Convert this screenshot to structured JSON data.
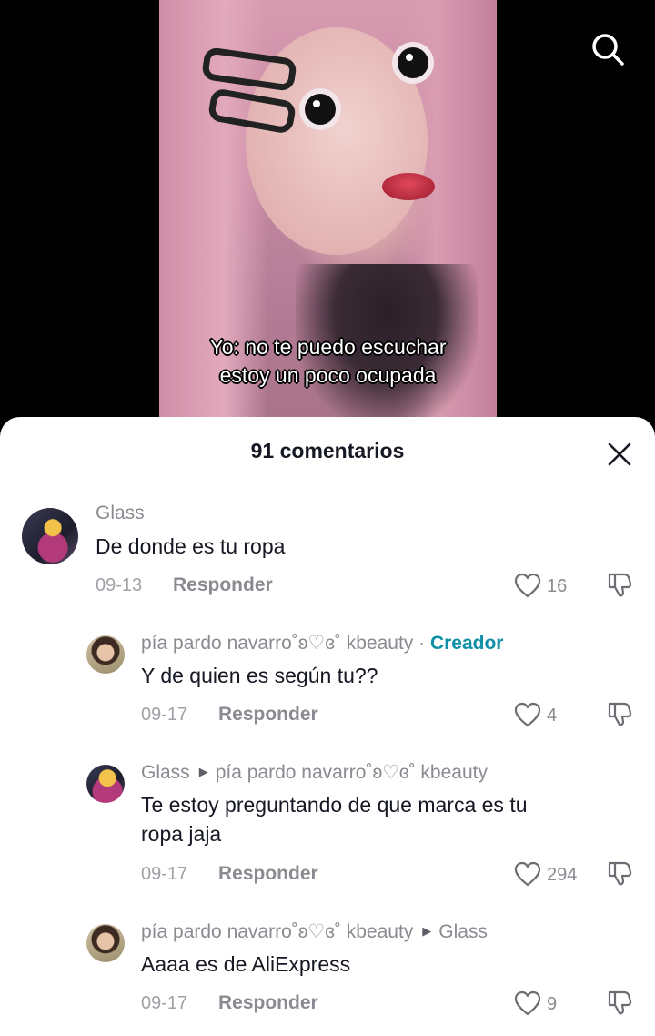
{
  "video": {
    "caption_line1": "Yo: no te puedo escuchar",
    "caption_line2": "estoy un poco ocupada",
    "search_icon": "search-icon"
  },
  "comments_sheet": {
    "title": "91 comentarios",
    "close_icon": "close-icon",
    "comments": [
      {
        "username": "Glass",
        "text": "De donde es tu ropa",
        "date": "09-13",
        "reply_label": "Responder",
        "likes": "16",
        "avatar": "avatar-glass"
      },
      {
        "username": "pía pardo navarro˚ʚ♡ɞ˚ kbeauty",
        "separator": " · ",
        "creator_badge": "Creador",
        "text": "Y de quien es según tu??",
        "date": "09-17",
        "reply_label": "Responder",
        "likes": "4",
        "avatar": "avatar-pia"
      },
      {
        "username": "Glass",
        "reply_to": "pía pardo navarro˚ʚ♡ɞ˚ kbeauty",
        "text_line1": "Te estoy preguntando de que marca es tu",
        "text_line2": "ropa jaja",
        "date": "09-17",
        "reply_label": "Responder",
        "likes": "294",
        "avatar": "avatar-glass"
      },
      {
        "username": "pía pardo navarro˚ʚ♡ɞ˚ kbeauty",
        "reply_to": "Glass",
        "text": "Aaaa es de AliExpress",
        "date": "09-17",
        "reply_label": "Responder",
        "likes": "9",
        "avatar": "avatar-pia"
      }
    ]
  },
  "colors": {
    "creator": "#0f8fa8",
    "muted": "#8a8b91",
    "text": "#161823"
  }
}
